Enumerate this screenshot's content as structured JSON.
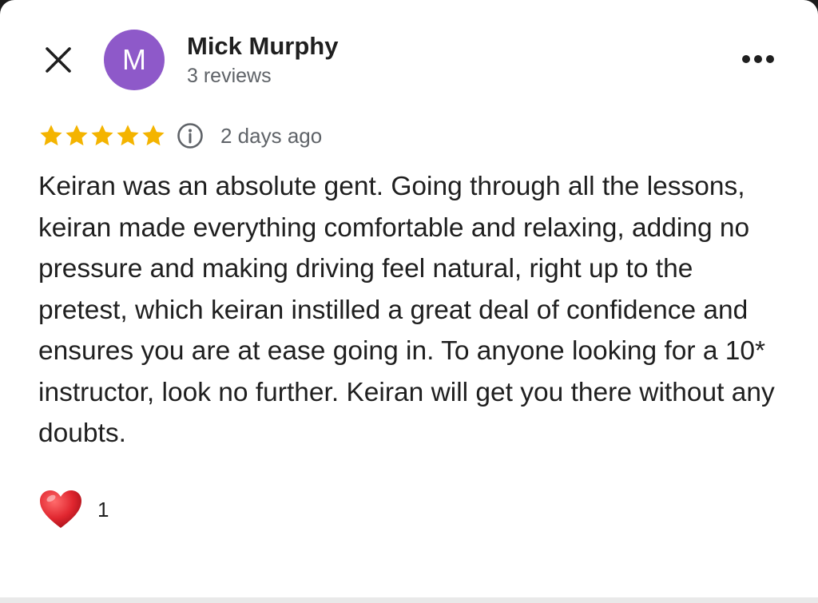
{
  "author": {
    "initial": "M",
    "name": "Mick Murphy",
    "reviews": "3 reviews",
    "avatar_color": "#8e59c9"
  },
  "icons": {
    "close": "close-icon",
    "more": "more-horizontal-icon",
    "info": "info-icon",
    "star": "star-icon",
    "heart": "heart-icon"
  },
  "rating": {
    "stars": 5,
    "max": 5,
    "star_color": "#f4b400"
  },
  "date": "2 days ago",
  "review": {
    "text": "Keiran was an absolute gent. Going through all the lessons, keiran made everything comfortable and relaxing, adding no pressure and making driving feel natural, right up to the pretest, which keiran instilled a great deal of confidence and ensures you are at ease going in. To anyone looking for a 10* instructor, look no further. Keiran will get you there without any doubts."
  },
  "reaction": {
    "count": "1",
    "heart_color": "#e0262f"
  }
}
